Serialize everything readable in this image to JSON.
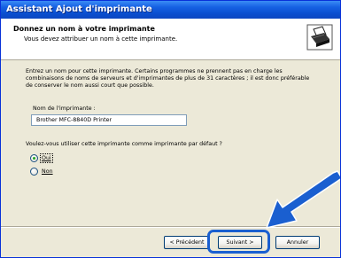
{
  "window": {
    "title": "Assistant Ajout d'imprimante"
  },
  "header": {
    "title": "Donnez un nom à votre imprimante",
    "subtitle": "Vous devez attribuer un nom à cette imprimante.",
    "icon": "printer-icon"
  },
  "content": {
    "paragraph": "Entrez un nom pour cette imprimante. Certains programmes ne prennent pas en charge les combinaisons de noms de serveurs et d'imprimantes de plus de 31 caractères ; il est donc préférable de conserver le nom aussi court que possible.",
    "printer_name_label": "Nom de l'imprimante :",
    "printer_name_value": "Brother MFC-8840D Printer",
    "default_question": "Voulez-vous utiliser cette imprimante comme imprimante par défaut ?",
    "options": [
      {
        "label": "Oui",
        "selected": true
      },
      {
        "label": "Non",
        "selected": false
      }
    ]
  },
  "buttons": {
    "previous": "< Précédent",
    "next": "Suivant >",
    "cancel": "Annuler"
  },
  "colors": {
    "titlebar": "#0a4fd0",
    "highlight": "#1a5fd0",
    "arrow": "#1a5fd0"
  }
}
